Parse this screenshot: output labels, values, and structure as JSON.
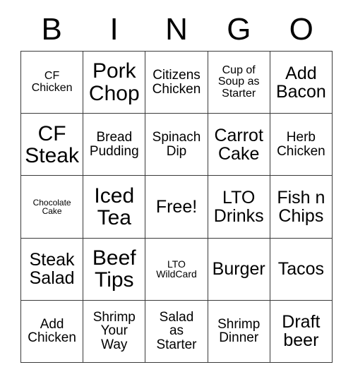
{
  "card": {
    "header_letters": [
      "B",
      "I",
      "N",
      "G",
      "O"
    ],
    "columns": 5,
    "rows": 5,
    "border_color": "#3a3a3a",
    "cell_background": "#ffffff",
    "text_color": "#000000",
    "cells": [
      {
        "text": "CF\nChicken",
        "size": "sm"
      },
      {
        "text": "Pork\nChop",
        "size": "xl"
      },
      {
        "text": "Citizens\nChicken",
        "size": "md"
      },
      {
        "text": "Cup of\nSoup as\nStarter",
        "size": "sm"
      },
      {
        "text": "Add\nBacon",
        "size": "lg"
      },
      {
        "text": "CF\nSteak",
        "size": "xl"
      },
      {
        "text": "Bread\nPudding",
        "size": "md"
      },
      {
        "text": "Spinach\nDip",
        "size": "md"
      },
      {
        "text": "Carrot\nCake",
        "size": "lg"
      },
      {
        "text": "Herb\nChicken",
        "size": "md"
      },
      {
        "text": "Chocolate\nCake",
        "size": "xxs"
      },
      {
        "text": "Iced\nTea",
        "size": "xl"
      },
      {
        "text": "Free!",
        "size": "lg"
      },
      {
        "text": "LTO\nDrinks",
        "size": "lg"
      },
      {
        "text": "Fish n\nChips",
        "size": "lg"
      },
      {
        "text": "Steak\nSalad",
        "size": "lg"
      },
      {
        "text": "Beef\nTips",
        "size": "xl"
      },
      {
        "text": "LTO\nWildCard",
        "size": "xs"
      },
      {
        "text": "Burger",
        "size": "lg"
      },
      {
        "text": "Tacos",
        "size": "lg"
      },
      {
        "text": "Add\nChicken",
        "size": "md"
      },
      {
        "text": "Shrimp\nYour\nWay",
        "size": "md"
      },
      {
        "text": "Salad\nas\nStarter",
        "size": "md"
      },
      {
        "text": "Shrimp\nDinner",
        "size": "md"
      },
      {
        "text": "Draft\nbeer",
        "size": "lg"
      }
    ]
  }
}
